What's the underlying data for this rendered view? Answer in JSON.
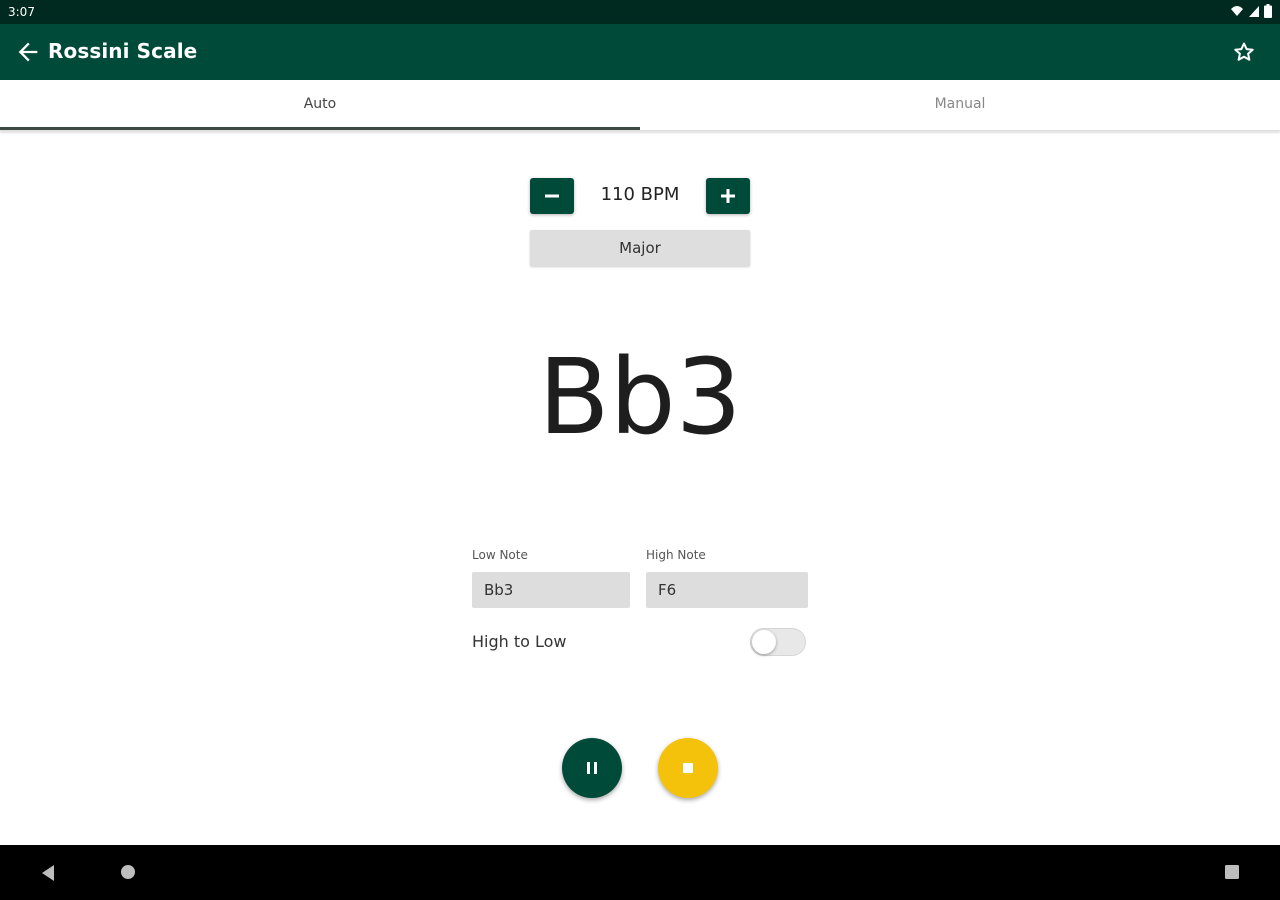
{
  "status_bar": {
    "time": "3:07"
  },
  "app_bar": {
    "title": "Rossini Scale"
  },
  "tabs": [
    {
      "label": "Auto",
      "selected": true
    },
    {
      "label": "Manual",
      "selected": false
    }
  ],
  "tempo": {
    "bpm_text": "110 BPM"
  },
  "scale": {
    "selected": "Major"
  },
  "current_note": "Bb3",
  "range": {
    "low_label": "Low Note",
    "low_value": "Bb3",
    "high_label": "High Note",
    "high_value": "F6"
  },
  "direction": {
    "label": "High to Low",
    "enabled": false
  },
  "colors": {
    "primary": "#004a3a",
    "status_bar": "#002a1f",
    "accent_stop": "#f5c20b"
  },
  "icons": {
    "back": "arrow-left",
    "favorite": "star-outline",
    "decrement": "minus",
    "increment": "plus",
    "pause": "pause",
    "stop": "stop"
  }
}
